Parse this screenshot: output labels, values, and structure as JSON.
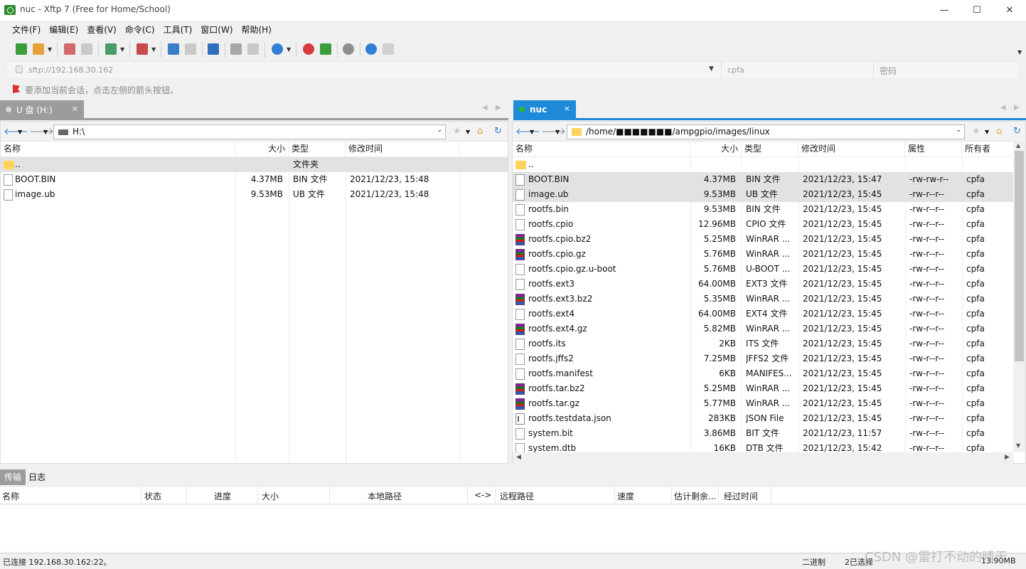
{
  "window": {
    "title": "nuc - Xftp 7 (Free for Home/School)",
    "minimize": "—",
    "maximize": "☐",
    "close": "✕"
  },
  "menu": [
    "文件(F)",
    "编辑(E)",
    "查看(V)",
    "命令(C)",
    "工具(T)",
    "窗口(W)",
    "帮助(H)"
  ],
  "address": {
    "url": "sftp://192.168.30.162",
    "user": "cpfa",
    "password": "密码"
  },
  "hint": "要添加当前会话，点击左侧的箭头按钮。",
  "left": {
    "tab": {
      "label": "U 盘 (H:)",
      "close": "×"
    },
    "path": "H:\\",
    "columns": {
      "name": "名称",
      "size": "大小",
      "type": "类型",
      "modified": "修改时间"
    },
    "rows": [
      {
        "icon": "folder",
        "name": "..",
        "size": "",
        "type": "文件夹",
        "modified": ""
      },
      {
        "icon": "file",
        "name": "BOOT.BIN",
        "size": "4.37MB",
        "type": "BIN 文件",
        "modified": "2021/12/23, 15:48"
      },
      {
        "icon": "file",
        "name": "image.ub",
        "size": "9.53MB",
        "type": "UB 文件",
        "modified": "2021/12/23, 15:48"
      }
    ]
  },
  "right": {
    "tab": {
      "label": "nuc",
      "close": "×"
    },
    "path": "/home/■■■■■■■/ampgpio/images/linux",
    "columns": {
      "name": "名称",
      "size": "大小",
      "type": "类型",
      "modified": "修改时间",
      "attr": "属性",
      "owner": "所有者"
    },
    "rows": [
      {
        "icon": "folder",
        "name": "..",
        "size": "",
        "type": "",
        "modified": "",
        "attr": "",
        "owner": ""
      },
      {
        "icon": "file",
        "name": "BOOT.BIN",
        "size": "4.37MB",
        "type": "BIN 文件",
        "modified": "2021/12/23, 15:47",
        "attr": "-rw-rw-r--",
        "owner": "cpfa"
      },
      {
        "icon": "file",
        "name": "image.ub",
        "size": "9.53MB",
        "type": "UB 文件",
        "modified": "2021/12/23, 15:45",
        "attr": "-rw-r--r--",
        "owner": "cpfa"
      },
      {
        "icon": "file",
        "name": "rootfs.bin",
        "size": "9.53MB",
        "type": "BIN 文件",
        "modified": "2021/12/23, 15:45",
        "attr": "-rw-r--r--",
        "owner": "cpfa"
      },
      {
        "icon": "file",
        "name": "rootfs.cpio",
        "size": "12.96MB",
        "type": "CPIO 文件",
        "modified": "2021/12/23, 15:45",
        "attr": "-rw-r--r--",
        "owner": "cpfa"
      },
      {
        "icon": "rar",
        "name": "rootfs.cpio.bz2",
        "size": "5.25MB",
        "type": "WinRAR ...",
        "modified": "2021/12/23, 15:45",
        "attr": "-rw-r--r--",
        "owner": "cpfa"
      },
      {
        "icon": "rar",
        "name": "rootfs.cpio.gz",
        "size": "5.76MB",
        "type": "WinRAR ...",
        "modified": "2021/12/23, 15:45",
        "attr": "-rw-r--r--",
        "owner": "cpfa"
      },
      {
        "icon": "file",
        "name": "rootfs.cpio.gz.u-boot",
        "size": "5.76MB",
        "type": "U-BOOT ...",
        "modified": "2021/12/23, 15:45",
        "attr": "-rw-r--r--",
        "owner": "cpfa"
      },
      {
        "icon": "file",
        "name": "rootfs.ext3",
        "size": "64.00MB",
        "type": "EXT3 文件",
        "modified": "2021/12/23, 15:45",
        "attr": "-rw-r--r--",
        "owner": "cpfa"
      },
      {
        "icon": "rar",
        "name": "rootfs.ext3.bz2",
        "size": "5.35MB",
        "type": "WinRAR ...",
        "modified": "2021/12/23, 15:45",
        "attr": "-rw-r--r--",
        "owner": "cpfa"
      },
      {
        "icon": "file",
        "name": "rootfs.ext4",
        "size": "64.00MB",
        "type": "EXT4 文件",
        "modified": "2021/12/23, 15:45",
        "attr": "-rw-r--r--",
        "owner": "cpfa"
      },
      {
        "icon": "rar",
        "name": "rootfs.ext4.gz",
        "size": "5.82MB",
        "type": "WinRAR ...",
        "modified": "2021/12/23, 15:45",
        "attr": "-rw-r--r--",
        "owner": "cpfa"
      },
      {
        "icon": "file",
        "name": "rootfs.its",
        "size": "2KB",
        "type": "ITS 文件",
        "modified": "2021/12/23, 15:45",
        "attr": "-rw-r--r--",
        "owner": "cpfa"
      },
      {
        "icon": "file",
        "name": "rootfs.jffs2",
        "size": "7.25MB",
        "type": "JFFS2 文件",
        "modified": "2021/12/23, 15:45",
        "attr": "-rw-r--r--",
        "owner": "cpfa"
      },
      {
        "icon": "file",
        "name": "rootfs.manifest",
        "size": "6KB",
        "type": "MANIFES...",
        "modified": "2021/12/23, 15:45",
        "attr": "-rw-r--r--",
        "owner": "cpfa"
      },
      {
        "icon": "rar",
        "name": "rootfs.tar.bz2",
        "size": "5.25MB",
        "type": "WinRAR ...",
        "modified": "2021/12/23, 15:45",
        "attr": "-rw-r--r--",
        "owner": "cpfa"
      },
      {
        "icon": "rar",
        "name": "rootfs.tar.gz",
        "size": "5.77MB",
        "type": "WinRAR ...",
        "modified": "2021/12/23, 15:45",
        "attr": "-rw-r--r--",
        "owner": "cpfa"
      },
      {
        "icon": "json",
        "name": "rootfs.testdata.json",
        "size": "283KB",
        "type": "JSON File",
        "modified": "2021/12/23, 15:45",
        "attr": "-rw-r--r--",
        "owner": "cpfa"
      },
      {
        "icon": "file",
        "name": "system.bit",
        "size": "3.86MB",
        "type": "BIT 文件",
        "modified": "2021/12/23, 11:57",
        "attr": "-rw-r--r--",
        "owner": "cpfa"
      },
      {
        "icon": "file",
        "name": "system.dtb",
        "size": "16KB",
        "type": "DTB 文件",
        "modified": "2021/12/23, 15:42",
        "attr": "-rw-r--r--",
        "owner": "cpfa"
      }
    ]
  },
  "transfer": {
    "tabs": {
      "transfer": "传输",
      "log": "日志"
    },
    "columns": {
      "name": "名称",
      "status": "状态",
      "progress": "进度",
      "size": "大小",
      "local": "本地路径",
      "dir": "<->",
      "remote": "远程路径",
      "speed": "速度",
      "eta": "估计剩余...",
      "elapsed": "经过时间"
    }
  },
  "status": {
    "connection": "已连接 192.168.30.162:22。",
    "mode": "二进制",
    "selected": "2已选择",
    "size": "13.90MB"
  },
  "watermark": "CSDN @雷打不动的晴天",
  "colors": {
    "active_tab": "#1f8ad7",
    "inactive_tab": "#9c9c9c",
    "selected_row": "#e2e2e2",
    "left_tab_dot": "#d8d8d8",
    "right_tab_dot": "#2fb52f"
  }
}
